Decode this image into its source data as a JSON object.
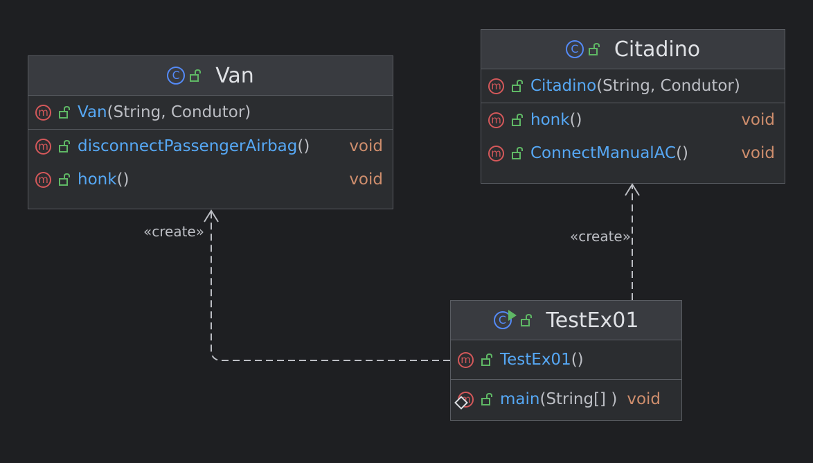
{
  "classes": {
    "van": {
      "name": "Van",
      "kind_icon": "class-icon",
      "visibility_icon": "public-lock-icon",
      "constructors": [
        {
          "name": "Van",
          "params": "(String, Condutor)"
        }
      ],
      "methods": [
        {
          "name": "disconnectPassengerAirbag",
          "params": "()",
          "return_type": "void"
        },
        {
          "name": "honk",
          "params": "()",
          "return_type": "void"
        }
      ]
    },
    "citadino": {
      "name": "Citadino",
      "kind_icon": "class-icon",
      "visibility_icon": "public-lock-icon",
      "constructors": [
        {
          "name": "Citadino",
          "params": "(String, Condutor)"
        }
      ],
      "methods": [
        {
          "name": "honk",
          "params": "()",
          "return_type": "void"
        },
        {
          "name": "ConnectManualAC",
          "params": "()",
          "return_type": "void"
        }
      ]
    },
    "testex01": {
      "name": "TestEx01",
      "kind_icon": "runnable-class-icon",
      "visibility_icon": "public-lock-icon",
      "constructors": [
        {
          "name": "TestEx01",
          "params": "()"
        }
      ],
      "methods": [
        {
          "name": "main",
          "params": "(String[] )",
          "return_type": "void",
          "static": true
        }
      ]
    }
  },
  "relations": [
    {
      "from": "TestEx01",
      "to": "Van",
      "label": "«create»",
      "style": "dashed"
    },
    {
      "from": "TestEx01",
      "to": "Citadino",
      "label": "«create»",
      "style": "dashed"
    }
  ],
  "colors": {
    "background": "#1e1f22",
    "box_fill": "#2b2d30",
    "header_fill": "#393b40",
    "border": "#5a5d63",
    "method_icon": "#d4585a",
    "class_icon": "#548af7",
    "lock_icon": "#5fb865",
    "member_name": "#56a8f5",
    "params": "#bcbec4",
    "return_type": "#cf8e6d",
    "edge": "#bcbec4"
  }
}
